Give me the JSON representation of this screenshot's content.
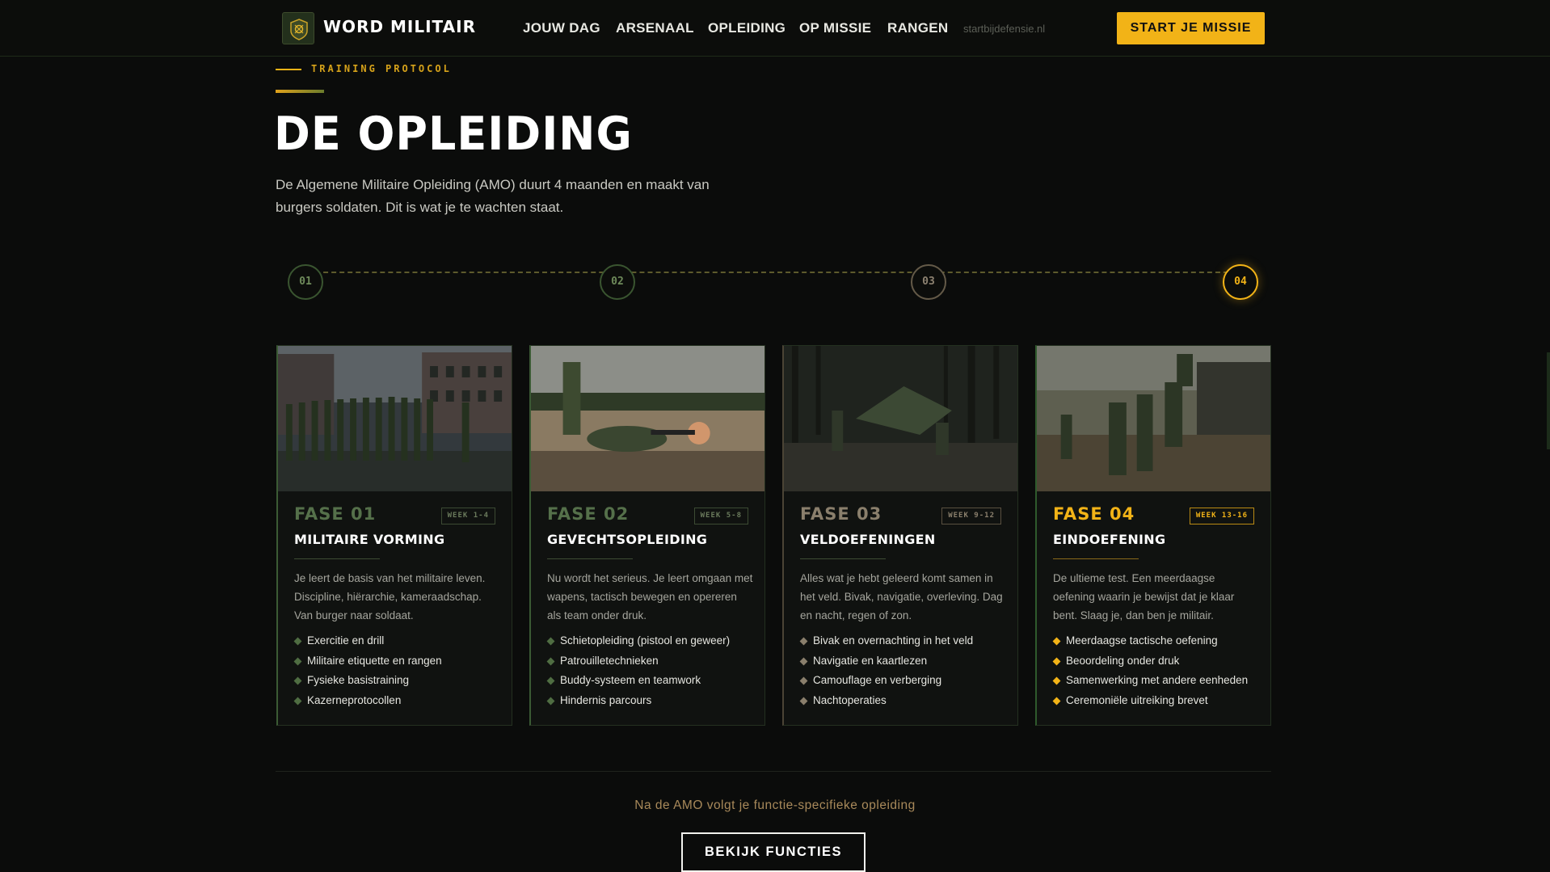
{
  "nav": {
    "brand": "WORD MILITAIR",
    "logo_icon": "emblem-icon",
    "items": [
      {
        "label": "JOUW DAG"
      },
      {
        "label": "ARSENAAL"
      },
      {
        "label": "OPLEIDING"
      },
      {
        "label": "OP MISSIE"
      },
      {
        "label": "RANGEN"
      }
    ],
    "url": "startbijdefensie.nl",
    "cta": "START JE MISSIE"
  },
  "section": {
    "eyebrow": "TRAINING PROTOCOL",
    "title": "DE OPLEIDING",
    "intro": "De Algemene Militaire Opleiding (AMO) duurt 4 maanden en maakt van burgers soldaten. Dit is wat je te wachten staat."
  },
  "timeline": {
    "steps": [
      "01",
      "02",
      "03",
      "04"
    ],
    "active": "04"
  },
  "phases": [
    {
      "phase": "FASE 01",
      "week": "WEEK 1-4",
      "title": "MILITAIRE VORMING",
      "desc": "Je leert de basis van het militaire leven. Discipline, hiërarchie, kameraadschap. Van burger naar soldaat.",
      "bullets": [
        "Exercitie en drill",
        "Militaire etiquette en rangen",
        "Fysieke basistraining",
        "Kazerneprotocollen"
      ]
    },
    {
      "phase": "FASE 02",
      "week": "WEEK 5-8",
      "title": "GEVECHTSOPLEIDING",
      "desc": "Nu wordt het serieus. Je leert omgaan met wapens, tactisch bewegen en opereren als team onder druk.",
      "bullets": [
        "Schietopleiding (pistool en geweer)",
        "Patrouilletechnieken",
        "Buddy-systeem en teamwork",
        "Hindernis parcours"
      ]
    },
    {
      "phase": "FASE 03",
      "week": "WEEK 9-12",
      "title": "VELDOEFENINGEN",
      "desc": "Alles wat je hebt geleerd komt samen in het veld. Bivak, navigatie, overleving. Dag en nacht, regen of zon.",
      "bullets": [
        "Bivak en overnachting in het veld",
        "Navigatie en kaartlezen",
        "Camouflage en verberging",
        "Nachtoperaties"
      ]
    },
    {
      "phase": "FASE 04",
      "week": "WEEK 13-16",
      "title": "EINDOEFENING",
      "desc": "De ultieme test. Een meerdaagse oefening waarin je bewijst dat je klaar bent. Slaag je, dan ben je militair.",
      "bullets": [
        "Meerdaagse tactische oefening",
        "Beoordeling onder druk",
        "Samenwerking met andere eenheden",
        "Ceremoniële uitreiking brevet"
      ]
    }
  ],
  "footer": {
    "note": "Na de AMO volgt je functie-specifieke opleiding",
    "button": "BEKIJK FUNCTIES"
  },
  "colors": {
    "accent": "#f2b317",
    "background": "#0b0c0b",
    "army_green": "#55704a"
  }
}
